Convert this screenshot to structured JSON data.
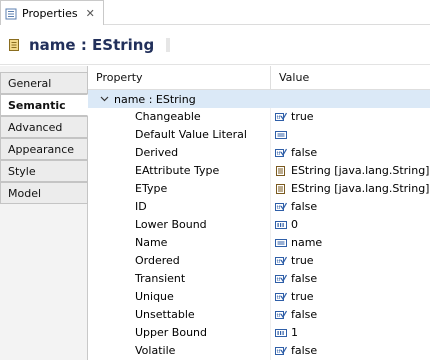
{
  "view_tab": {
    "title": "Properties",
    "close_glyph": "✕"
  },
  "header": {
    "title": "name : EString",
    "icon": "attribute-icon"
  },
  "categories": [
    {
      "label": "General",
      "active": false
    },
    {
      "label": "Semantic",
      "active": true
    },
    {
      "label": "Advanced",
      "active": false
    },
    {
      "label": "Appearance",
      "active": false
    },
    {
      "label": "Style",
      "active": false
    },
    {
      "label": "Model",
      "active": false
    }
  ],
  "table": {
    "columns": {
      "property": "Property",
      "value": "Value"
    },
    "group": {
      "label": "name : EString",
      "expanded": true
    },
    "rows": [
      {
        "property": "Changeable",
        "value": "true",
        "icon": "boolean-icon"
      },
      {
        "property": "Default Value Literal",
        "value": "",
        "icon": "text-icon"
      },
      {
        "property": "Derived",
        "value": "false",
        "icon": "boolean-icon"
      },
      {
        "property": "EAttribute Type",
        "value": "EString [java.lang.String]",
        "icon": "datatype-icon"
      },
      {
        "property": "EType",
        "value": "EString [java.lang.String]",
        "icon": "datatype-icon"
      },
      {
        "property": "ID",
        "value": "false",
        "icon": "boolean-icon"
      },
      {
        "property": "Lower Bound",
        "value": "0",
        "icon": "integer-icon"
      },
      {
        "property": "Name",
        "value": "name",
        "icon": "text-icon"
      },
      {
        "property": "Ordered",
        "value": "true",
        "icon": "boolean-icon"
      },
      {
        "property": "Transient",
        "value": "false",
        "icon": "boolean-icon"
      },
      {
        "property": "Unique",
        "value": "true",
        "icon": "boolean-icon"
      },
      {
        "property": "Unsettable",
        "value": "false",
        "icon": "boolean-icon"
      },
      {
        "property": "Upper Bound",
        "value": "1",
        "icon": "integer-icon"
      },
      {
        "property": "Volatile",
        "value": "false",
        "icon": "boolean-icon"
      }
    ]
  },
  "colors": {
    "selection_row": "#dbe9f7",
    "header_title": "#22305b",
    "icon_blue": "#2f5fa8"
  }
}
